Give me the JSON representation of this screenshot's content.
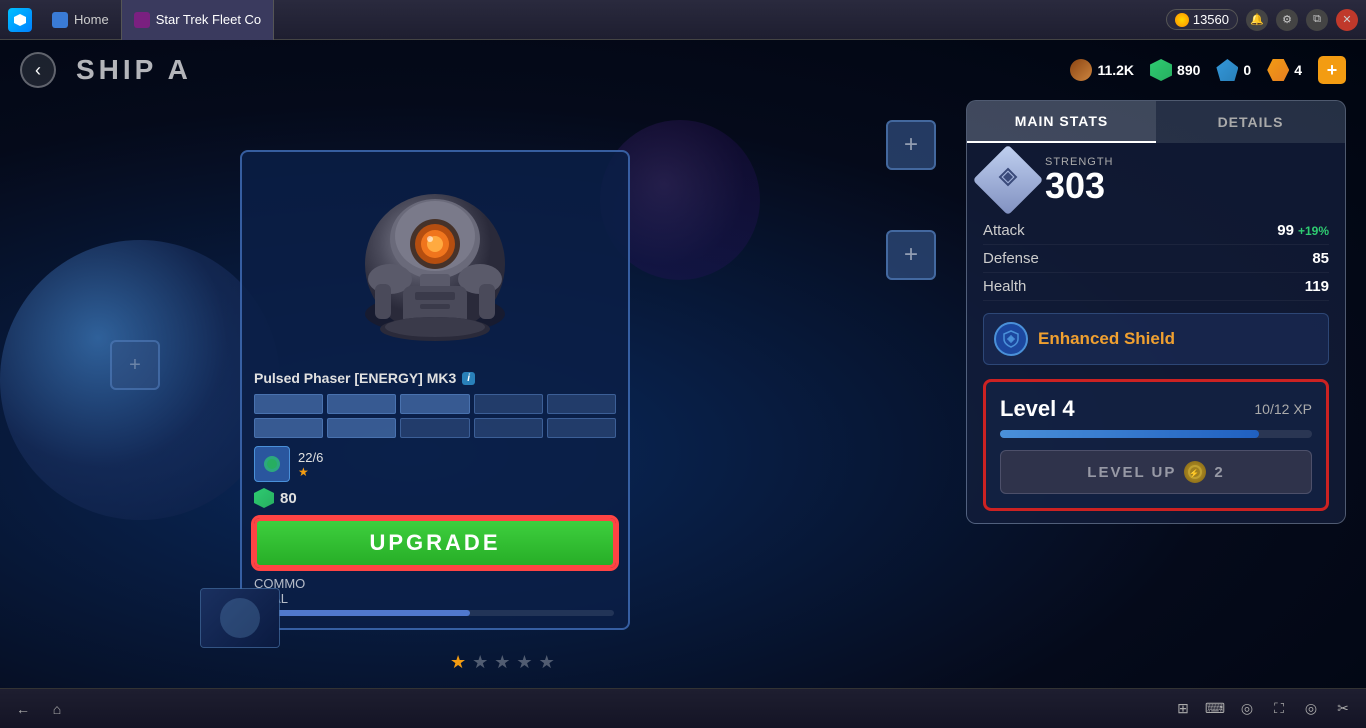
{
  "titlebar": {
    "app_name": "BlueStacks",
    "tabs": [
      {
        "label": "Home",
        "active": false
      },
      {
        "label": "Star Trek Fleet Co",
        "active": true
      }
    ],
    "currency": "13560",
    "controls": [
      "minimize",
      "maximize",
      "close"
    ]
  },
  "top_hud": {
    "back_label": "‹",
    "ship_name": "SHIP A",
    "resources": [
      {
        "type": "wood",
        "value": "11.2K"
      },
      {
        "type": "steel",
        "value": "890"
      },
      {
        "type": "crystal",
        "value": "0"
      },
      {
        "type": "dilithium",
        "value": "4"
      }
    ],
    "add_label": "+"
  },
  "tabs": {
    "main_stats_label": "MAIN STATS",
    "details_label": "DETAILS",
    "active": "MAIN STATS"
  },
  "stats": {
    "strength_label": "STRENGTH",
    "strength_value": "303",
    "attack_label": "Attack",
    "attack_value": "99",
    "attack_bonus": "+19%",
    "defense_label": "Defense",
    "defense_value": "85",
    "health_label": "Health",
    "health_value": "119"
  },
  "enhancement": {
    "name": "Enhanced Shield"
  },
  "level_section": {
    "level_label": "Level 4",
    "xp_current": "10",
    "xp_max": "12",
    "xp_display": "10/12 XP",
    "xp_pct": 83,
    "level_up_label": "LEVEL UP",
    "level_up_cost": "2"
  },
  "ship_card": {
    "weapon_name": "Pulsed Phaser [ENERGY] MK3",
    "info_label": "i",
    "component_count": "22/6",
    "upgrade_cost": "80",
    "upgrade_label": "UPGRADE",
    "ship_label_line1": "COMMO",
    "ship_label_line2": "REAL"
  },
  "taskbar": {
    "back_icon": "←",
    "home_icon": "⌂",
    "grid_icon": "⊞",
    "keyboard_icon": "⌨",
    "eye_icon": "◎",
    "fullscreen_icon": "⛶",
    "location_icon": "◎",
    "scissors_icon": "✂"
  }
}
